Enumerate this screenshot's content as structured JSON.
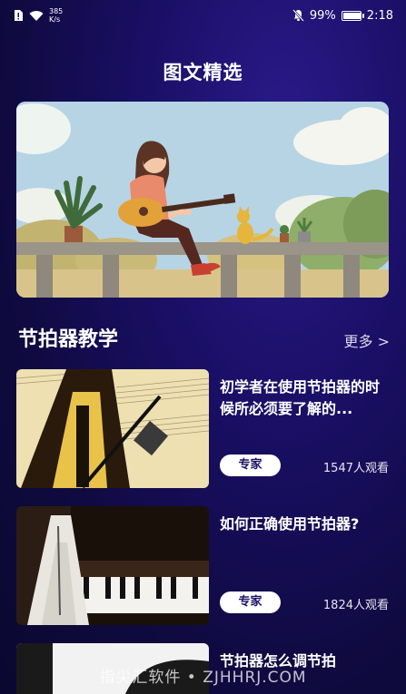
{
  "status_bar": {
    "net_speed_value": "385",
    "net_speed_unit": "K/s",
    "battery_percent": "99%",
    "battery_level": 0.99,
    "time": "2:18"
  },
  "page_title": "图文精选",
  "section": {
    "title": "节拍器教学",
    "more_label": "更多 >"
  },
  "articles": [
    {
      "title": "初学者在使用节拍器的时候所必须要了解的...",
      "badge": "专家",
      "views": "1547人观看"
    },
    {
      "title": "如何正确使用节拍器?",
      "badge": "专家",
      "views": "1824人观看"
    },
    {
      "title": "节拍器怎么调节拍"
    }
  ],
  "watermark": "指尖汇软件 • ZJHHRJ.COM",
  "colors": {
    "background": "#1a0f66",
    "accent": "#1c1468"
  }
}
